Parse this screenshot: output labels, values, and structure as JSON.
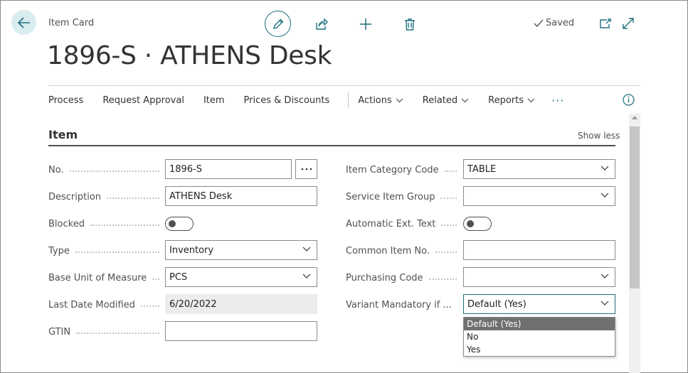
{
  "header": {
    "card_type": "Item Card",
    "title": "1896-S · ATHENS Desk",
    "saved_label": "Saved"
  },
  "actionbar": {
    "items": [
      "Process",
      "Request Approval",
      "Item",
      "Prices & Discounts"
    ],
    "menus": [
      "Actions",
      "Related",
      "Reports"
    ],
    "more": "···"
  },
  "section": {
    "title": "Item",
    "toggle_label": "Show less"
  },
  "fields_left": {
    "no": {
      "label": "No.",
      "value": "1896-S"
    },
    "description": {
      "label": "Description",
      "value": "ATHENS Desk"
    },
    "blocked": {
      "label": "Blocked"
    },
    "type": {
      "label": "Type",
      "value": "Inventory"
    },
    "base_uom": {
      "label": "Base Unit of Measure",
      "value": "PCS"
    },
    "last_modified": {
      "label": "Last Date Modified",
      "value": "6/20/2022"
    },
    "gtin": {
      "label": "GTIN",
      "value": ""
    }
  },
  "fields_right": {
    "category": {
      "label": "Item Category Code",
      "value": "TABLE"
    },
    "service_group": {
      "label": "Service Item Group",
      "value": ""
    },
    "auto_ext_text": {
      "label": "Automatic Ext. Text"
    },
    "common_item_no": {
      "label": "Common Item No.",
      "value": ""
    },
    "purchasing_code": {
      "label": "Purchasing Code",
      "value": ""
    },
    "variant_mandatory": {
      "label": "Variant Mandatory if ...",
      "value": "Default (Yes)",
      "options": [
        "Default (Yes)",
        "No",
        "Yes"
      ]
    }
  },
  "colors": {
    "accent": "#1e6f7e",
    "back_button_bg": "#d9ecef",
    "selected_option_bg": "#707070"
  },
  "icons": {
    "back": "arrow-left-icon",
    "edit": "pencil-icon",
    "share": "share-icon",
    "add": "plus-icon",
    "delete": "trash-icon",
    "saved": "check-icon",
    "popout": "popout-icon",
    "expand": "expand-icon",
    "info": "info-icon"
  }
}
